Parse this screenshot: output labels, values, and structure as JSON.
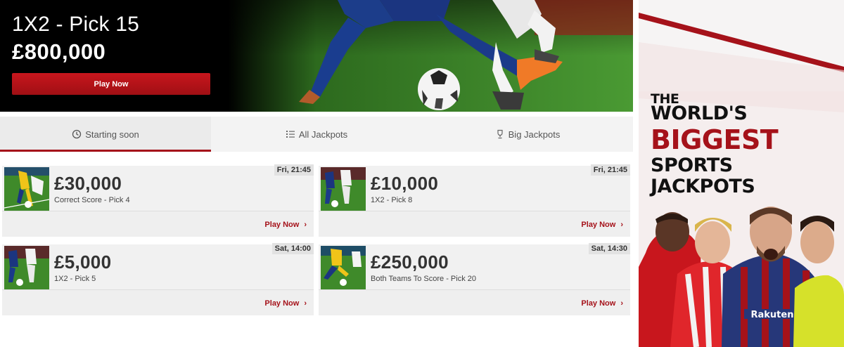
{
  "hero": {
    "title": "1X2 - Pick 15",
    "amount": "£800,000",
    "button_label": "Play Now"
  },
  "tabs": [
    {
      "label": "Starting soon",
      "icon": "clock-icon",
      "active": true
    },
    {
      "label": "All Jackpots",
      "icon": "list-icon",
      "active": false
    },
    {
      "label": "Big Jackpots",
      "icon": "trophy-icon",
      "active": false
    }
  ],
  "cards": [
    {
      "time": "Fri, 21:45",
      "amount": "£30,000",
      "subtitle": "Correct Score - Pick 4",
      "link": "Play Now"
    },
    {
      "time": "Fri, 21:45",
      "amount": "£10,000",
      "subtitle": "1X2 - Pick 8",
      "link": "Play Now"
    },
    {
      "time": "Sat, 14:00",
      "amount": "£5,000",
      "subtitle": "1X2 - Pick 5",
      "link": "Play Now"
    },
    {
      "time": "Sat, 14:30",
      "amount": "£250,000",
      "subtitle": "Both Teams To Score - Pick 20",
      "link": "Play Now"
    }
  ],
  "ad": {
    "line1": "THE",
    "line2": "WORLD'S",
    "line3": "BIGGEST",
    "line4": "SPORTS",
    "line5": "JACKPOTS",
    "shirt_text": "Rakuten"
  },
  "colors": {
    "accent": "#a5121a",
    "button": "#c8161d",
    "pitch": "#3f8a2a"
  }
}
